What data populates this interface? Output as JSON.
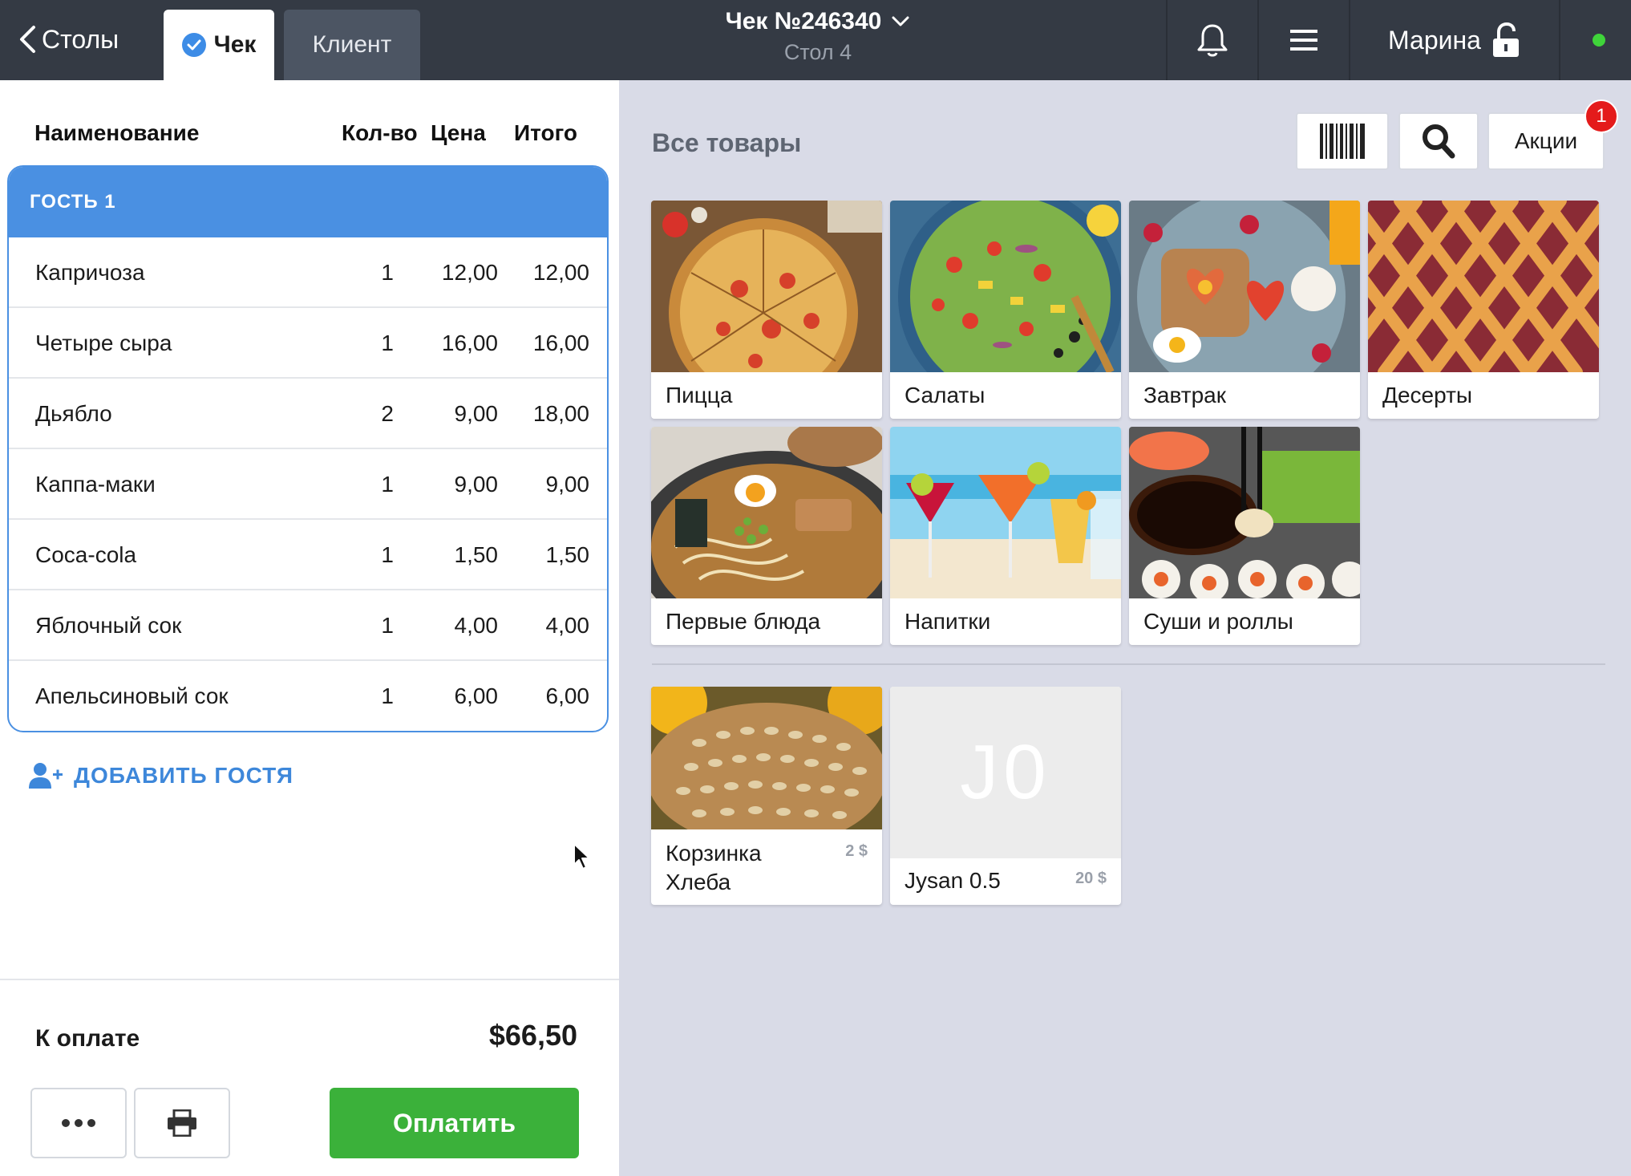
{
  "topbar": {
    "back_label": "Столы",
    "tabs": [
      {
        "label": "Чек",
        "active": true
      },
      {
        "label": "Клиент",
        "active": false
      }
    ],
    "receipt_title": "Чек №246340",
    "table_label": "Стол 4",
    "user_name": "Марина",
    "online_color": "#3fd43a"
  },
  "order": {
    "columns": {
      "name": "Наименование",
      "qty": "Кол-во",
      "price": "Цена",
      "total": "Итого"
    },
    "guest_label": "ГОСТЬ 1",
    "items": [
      {
        "name": "Капричоза",
        "qty": "1",
        "price": "12,00",
        "total": "12,00"
      },
      {
        "name": "Четыре сыра",
        "qty": "1",
        "price": "16,00",
        "total": "16,00"
      },
      {
        "name": "Дьябло",
        "qty": "2",
        "price": "9,00",
        "total": "18,00"
      },
      {
        "name": "Каппа-маки",
        "qty": "1",
        "price": "9,00",
        "total": "9,00"
      },
      {
        "name": "Coca-cola",
        "qty": "1",
        "price": "1,50",
        "total": "1,50"
      },
      {
        "name": "Яблочный сок",
        "qty": "1",
        "price": "4,00",
        "total": "4,00"
      },
      {
        "name": "Апельсиновый сок",
        "qty": "1",
        "price": "6,00",
        "total": "6,00"
      }
    ],
    "add_guest_label": "ДОБАВИТЬ ГОСТЯ",
    "to_pay_label": "К оплате",
    "to_pay_amount": "$66,50",
    "pay_button": "Оплатить"
  },
  "catalog": {
    "title": "Все товары",
    "promo_label": "Акции",
    "promo_badge": "1",
    "categories": [
      {
        "label": "Пицца",
        "icon": "pizza-image"
      },
      {
        "label": "Салаты",
        "icon": "salad-image"
      },
      {
        "label": "Завтрак",
        "icon": "breakfast-image"
      },
      {
        "label": "Десерты",
        "icon": "pie-image"
      },
      {
        "label": "Первые блюда",
        "icon": "ramen-image"
      },
      {
        "label": "Напитки",
        "icon": "cocktails-image"
      },
      {
        "label": "Суши и роллы",
        "icon": "sushi-image"
      }
    ],
    "products": [
      {
        "name": "Корзинка Хлеба",
        "price": "2 $",
        "icon": "bread-image"
      },
      {
        "name": "Jysan 0.5",
        "price": "20 $",
        "initials": "J0"
      }
    ]
  },
  "colors": {
    "topbar": "#343a44",
    "accent_blue": "#4a90e2",
    "pay_green": "#3bb13a",
    "badge_red": "#e41b1b",
    "catalog_bg": "#d9dbe7"
  }
}
